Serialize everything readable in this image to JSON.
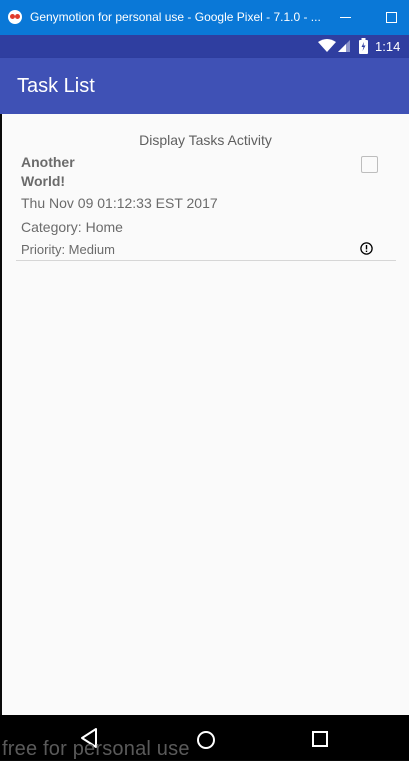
{
  "window": {
    "title": "Genymotion for personal use - Google Pixel - 7.1.0 - ..."
  },
  "status_bar": {
    "time": "1:14"
  },
  "app_bar": {
    "title": "Task List",
    "add_icon": "plus-icon"
  },
  "screen": {
    "heading": "Display Tasks Activity"
  },
  "task": {
    "title": "Another World!",
    "date": "Thu Nov 09 01:12:33 EST 2017",
    "category": "Category: Home",
    "priority": "Priority: Medium",
    "done": false,
    "priority_icon": "exclamation-circle-icon"
  },
  "nav_bar": {
    "back_icon": "back-triangle-icon",
    "home_icon": "home-circle-icon",
    "recents_icon": "recents-square-icon"
  },
  "watermark": "free for personal use",
  "colors": {
    "window_titlebar": "#0a78d7",
    "status_bar": "#2f3ea0",
    "app_bar": "#3f51b5",
    "background": "#fafafa"
  }
}
